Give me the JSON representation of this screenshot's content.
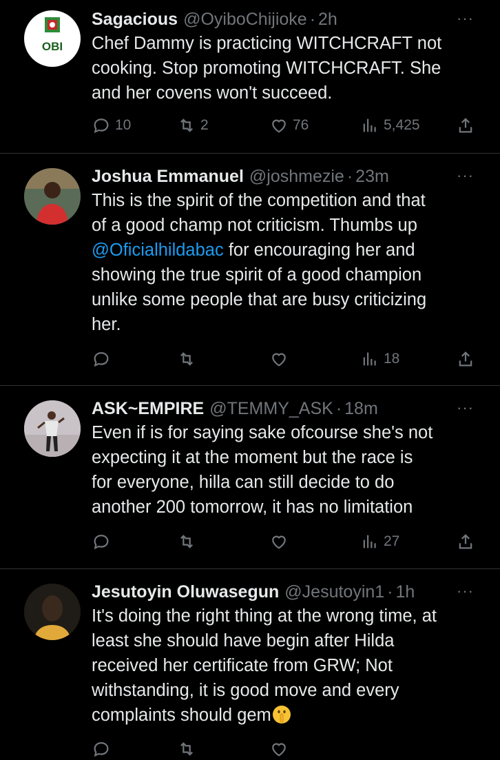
{
  "tweets": [
    {
      "name": "Sagacious",
      "handle": "@OyiboChijioke",
      "time": "2h",
      "avatar_text": "OBI",
      "text": "Chef Dammy is practicing WITCHCRAFT not\ncooking. Stop promoting WITCHCRAFT. She\nand her covens won't succeed.",
      "replies": "10",
      "retweets": "2",
      "likes": "76",
      "views": "5,425"
    },
    {
      "name": "Joshua Emmanuel",
      "handle": "@joshmezie",
      "time": "23m",
      "text_before": "This is the spirit of the competition and that\nof a good champ not criticism. Thumbs up\n",
      "mention": "@Oficialhildabac",
      "text_after": " for encouraging her and\nshowing the true spirit of a good champion\nunlike some people that are busy criticizing\nher.",
      "views": "18"
    },
    {
      "name": "ASK~EMPIRE",
      "handle": "@TEMMY_ASK",
      "time": "18m",
      "text": "Even if is for saying sake ofcourse she's not\nexpecting it at the moment but the race is\nfor everyone, hilla can still decide to do\nanother 200 tomorrow, it has no limitation",
      "views": "27"
    },
    {
      "name": "Jesutoyin Oluwasegun",
      "handle": "@Jesutoyin1",
      "time": "1h",
      "text": "It's doing the right thing at the wrong time, at\nleast she should have begin after Hilda\nreceived her certificate from GRW; Not\nwithstanding, it is good move and every\ncomplaints should gem",
      "emoji": "shushing-face"
    }
  ],
  "separator": "·",
  "more_label": "···"
}
